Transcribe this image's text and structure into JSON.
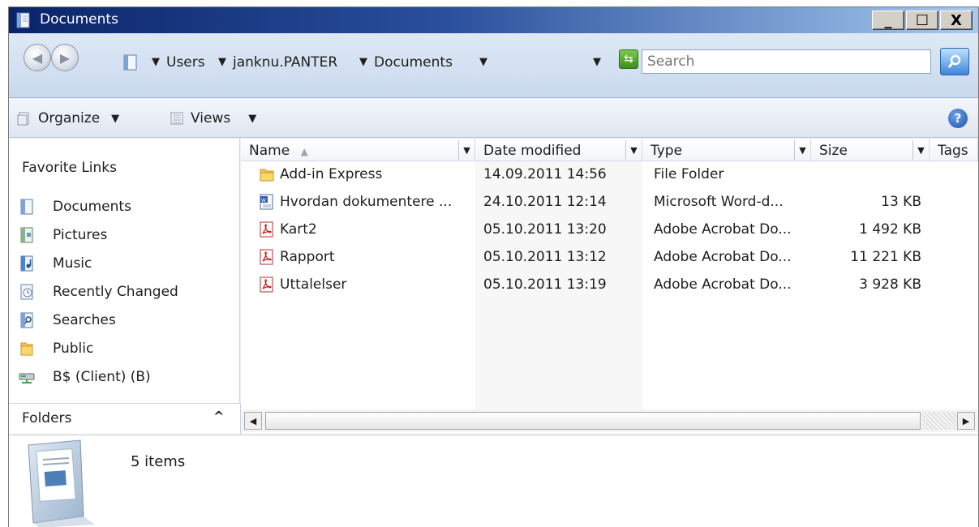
{
  "window": {
    "title": "Documents",
    "minimize_label": "_",
    "maximize_label": "☐",
    "close_label": "X"
  },
  "address_bar": {
    "path": [
      "Users",
      "janknu.PANTER",
      "Documents"
    ],
    "search_placeholder": "Search"
  },
  "toolbar": {
    "organize_label": "Organize",
    "views_label": "Views",
    "help_label": "?"
  },
  "sidebar": {
    "title": "Favorite Links",
    "items": [
      {
        "label": "Documents",
        "icon": "documents-icon"
      },
      {
        "label": "Pictures",
        "icon": "pictures-icon"
      },
      {
        "label": "Music",
        "icon": "music-icon"
      },
      {
        "label": "Recently Changed",
        "icon": "recently-changed-icon"
      },
      {
        "label": "Searches",
        "icon": "searches-icon"
      },
      {
        "label": "Public",
        "icon": "folder-icon"
      },
      {
        "label": "B$ (Client) (B)",
        "icon": "network-drive-icon"
      }
    ],
    "folders_label": "Folders"
  },
  "file_list": {
    "columns": [
      "Name",
      "Date modified",
      "Type",
      "Size",
      "Tags"
    ],
    "rows": [
      {
        "name": "Add-in Express",
        "date": "14.09.2011 14:56",
        "type": "File Folder",
        "size": "",
        "icon": "folder-icon"
      },
      {
        "name": "Hvordan dokumentere ...",
        "date": "24.10.2011 12:14",
        "type": "Microsoft Word-d...",
        "size": "13 KB",
        "icon": "word-doc-icon"
      },
      {
        "name": "Kart2",
        "date": "05.10.2011 13:20",
        "type": "Adobe Acrobat Do...",
        "size": "1 492 KB",
        "icon": "pdf-icon"
      },
      {
        "name": "Rapport",
        "date": "05.10.2011 13:12",
        "type": "Adobe Acrobat Do...",
        "size": "11 221 KB",
        "icon": "pdf-icon"
      },
      {
        "name": "Uttalelser",
        "date": "05.10.2011 13:19",
        "type": "Adobe Acrobat Do...",
        "size": "3 928 KB",
        "icon": "pdf-icon"
      }
    ]
  },
  "details": {
    "item_count": "5 items"
  }
}
